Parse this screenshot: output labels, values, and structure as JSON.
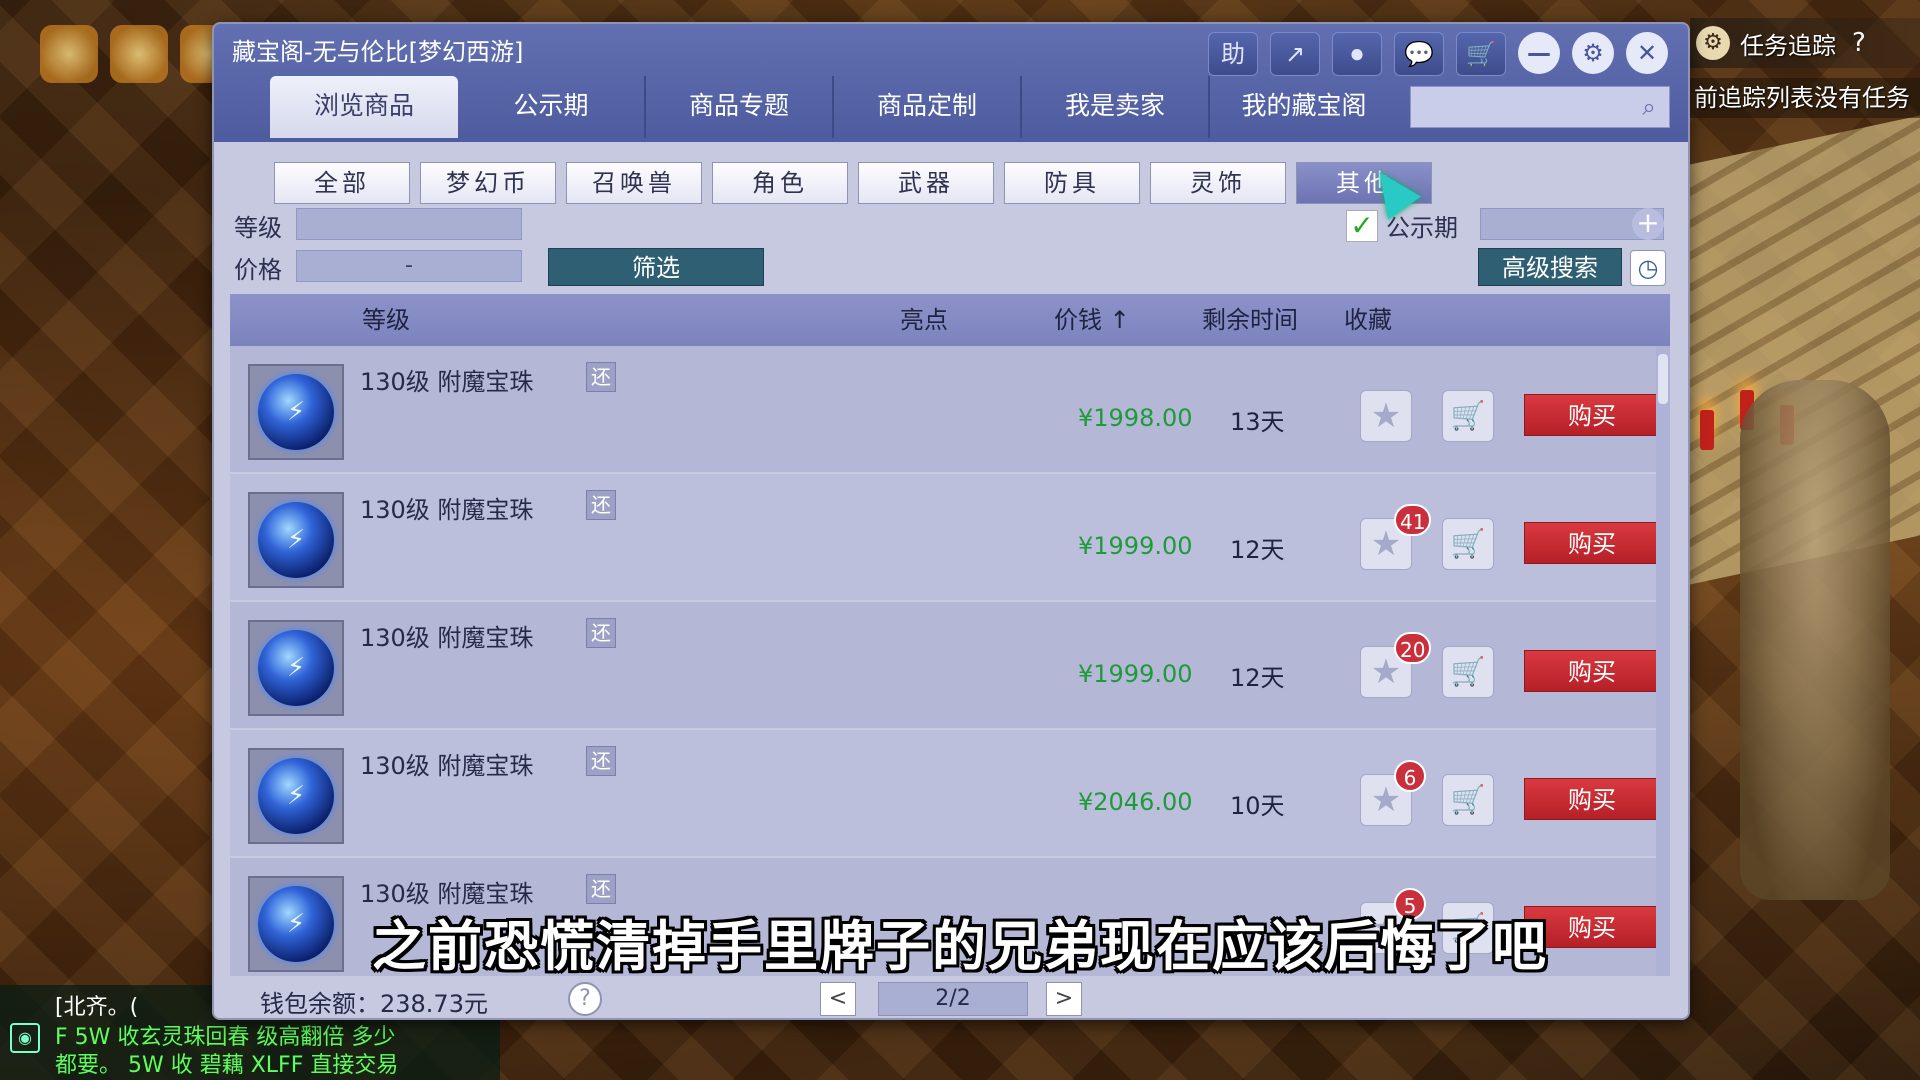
{
  "window": {
    "title": "藏宝阁-无与伦比[梦幻西游]",
    "buttons": [
      "助",
      "↗",
      "⏺",
      "💬",
      "🛒",
      "—",
      "⚙",
      "✕"
    ]
  },
  "tabs": [
    "浏览商品",
    "公示期",
    "商品专题",
    "商品定制",
    "我是卖家",
    "我的藏宝阁"
  ],
  "search": {
    "placeholder": ""
  },
  "categories": [
    "全部",
    "梦幻币",
    "召唤兽",
    "角色",
    "武器",
    "防具",
    "灵饰",
    "其他"
  ],
  "filters": {
    "level_label": "等级",
    "price_label": "价格",
    "price_sep": "-",
    "filter_button": "筛选",
    "public_label": "公示期",
    "public_checked": true,
    "advanced_button": "高级搜索"
  },
  "table": {
    "headers": {
      "level": "等级",
      "highlight": "亮点",
      "price": "价钱 ↑",
      "time": "剩余时间",
      "fav": "收藏"
    },
    "rows": [
      {
        "name": "130级  附魔宝珠",
        "tag": "还",
        "price": "¥1998.00",
        "time": "13天",
        "fav_count": "",
        "buy": "购买"
      },
      {
        "name": "130级  附魔宝珠",
        "tag": "还",
        "price": "¥1999.00",
        "time": "12天",
        "fav_count": "41",
        "buy": "购买"
      },
      {
        "name": "130级  附魔宝珠",
        "tag": "还",
        "price": "¥1999.00",
        "time": "12天",
        "fav_count": "20",
        "buy": "购买"
      },
      {
        "name": "130级  附魔宝珠",
        "tag": "还",
        "price": "¥2046.00",
        "time": "10天",
        "fav_count": "6",
        "buy": "购买"
      },
      {
        "name": "130级  附魔宝珠",
        "tag": "还",
        "price": "",
        "time": "",
        "fav_count": "5",
        "buy": "购买"
      }
    ]
  },
  "footer": {
    "wallet": "钱包余额：238.73元",
    "help": "?",
    "page": "2/2",
    "prev": "<",
    "next": ">"
  },
  "tracker": {
    "title": "任务追踪",
    "help": "?",
    "message": "前追踪列表没有任务"
  },
  "chat": {
    "name": "[北齐。(",
    "line1": "F  5W 收玄灵珠回春  级高翻倍 多少",
    "line2": "都要。  5W 收 碧藕 XLFF 直接交易"
  },
  "subtitle": "之前恐慌清掉手里牌子的兄弟现在应该后悔了吧",
  "colors": {
    "title_bar": "#5666a8",
    "buy_red": "#c42a31",
    "price_green": "#1f9a3a",
    "filter_teal": "#2f5f73"
  }
}
